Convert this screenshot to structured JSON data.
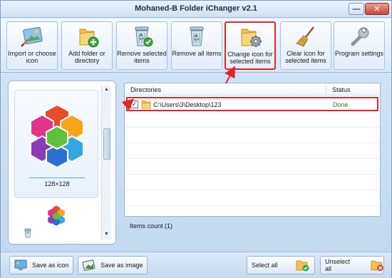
{
  "window": {
    "title": "Mohaned-B Folder iChanger v2.1",
    "minimize_glyph": "—",
    "close_glyph": "✕"
  },
  "toolbar": {
    "buttons": [
      {
        "label": "Import or choose icon",
        "icon": "import-image-icon"
      },
      {
        "label": "Add folder or directory",
        "icon": "add-folder-icon"
      },
      {
        "label": "Remove selected items",
        "icon": "recycle-bin-check-icon"
      },
      {
        "label": "Remove all items",
        "icon": "recycle-bin-icon"
      },
      {
        "label": "Change icon for selected items",
        "icon": "folder-gear-icon",
        "highlighted": true
      },
      {
        "label": "Clear icon for selected items",
        "icon": "broom-icon"
      },
      {
        "label": "Program settings",
        "icon": "wrench-icon"
      }
    ]
  },
  "preview": {
    "selected_size": "128×128"
  },
  "list": {
    "headers": {
      "directories": "Directories",
      "status": "Status"
    },
    "rows": [
      {
        "checked": true,
        "path": "C:\\Users\\3\\Desktop\\123",
        "status": "Done"
      }
    ],
    "items_count": "Items count (1)"
  },
  "bottom": {
    "save_as_icon": "Save as icon",
    "save_as_image": "Save as image",
    "select_all": "Select all",
    "unselect_all": "Unselect all"
  },
  "colors": {
    "highlight": "#e0262b",
    "done": "#1a8a1a",
    "accent": "#6aa3d9"
  }
}
